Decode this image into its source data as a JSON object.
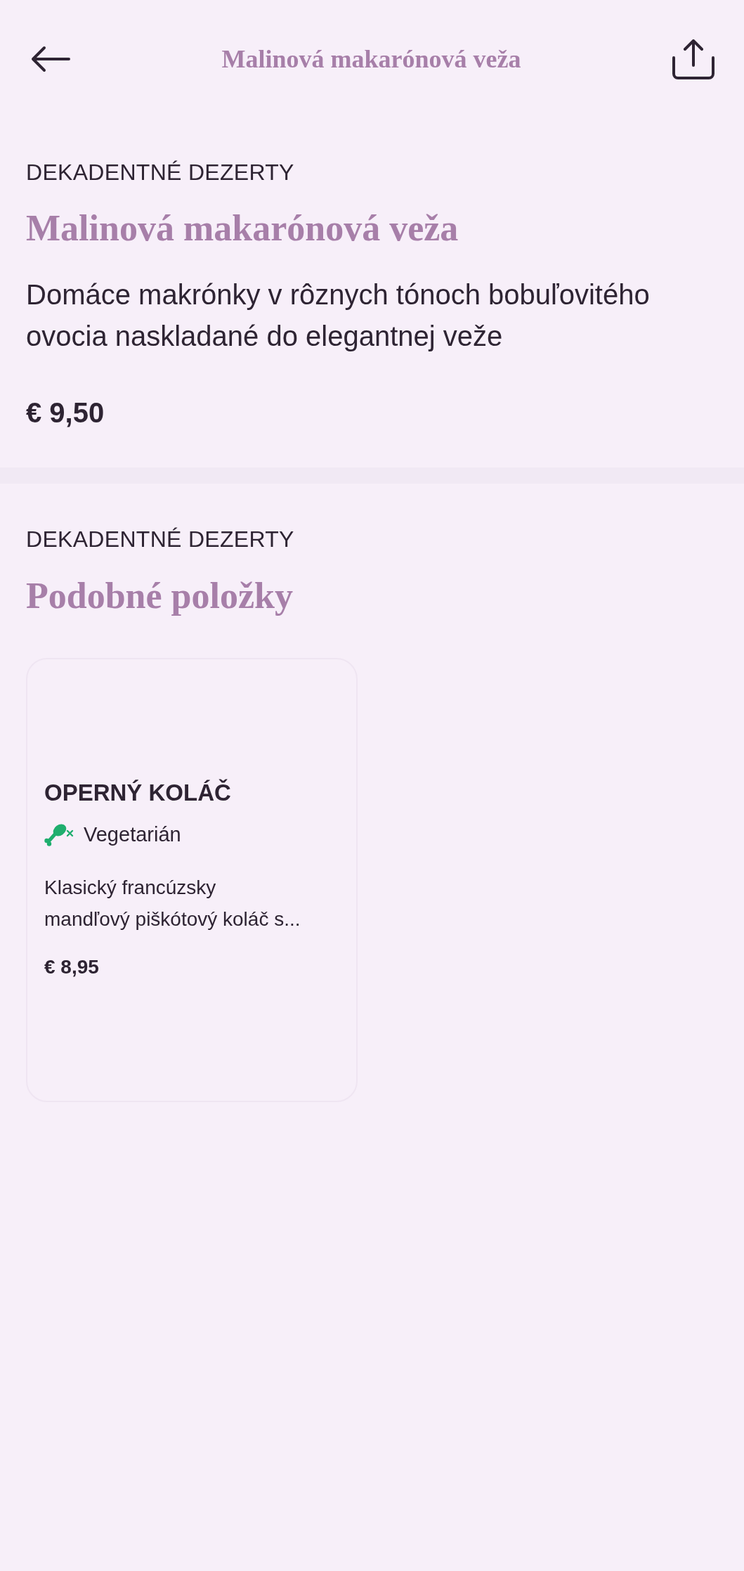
{
  "header": {
    "title": "Malinová makarónová veža"
  },
  "item": {
    "category": "DEKADENTNÉ DEZERTY",
    "name": "Malinová makarónová veža",
    "description": "Domáce makrónky v rôznych tónoch bobuľovitého ovocia naskladané do elegantnej veže",
    "price": "€ 9,50"
  },
  "similar": {
    "category": "DEKADENTNÉ DEZERTY",
    "title": "Podobné položky",
    "items": [
      {
        "name": "OPERNÝ KOLÁČ",
        "tags": [
          {
            "kind": "vegetarian",
            "label": "Vegetarián"
          }
        ],
        "description_lines": [
          "Klasický francúzsky",
          "mandľový piškótový koláč s..."
        ],
        "price": "€ 8,95"
      }
    ]
  }
}
